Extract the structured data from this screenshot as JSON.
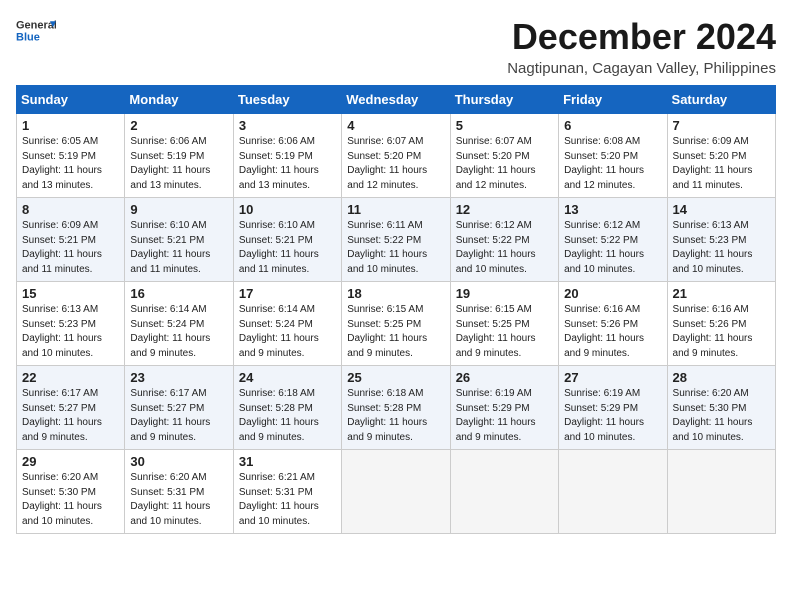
{
  "logo": {
    "line1": "General",
    "line2": "Blue"
  },
  "title": "December 2024",
  "location": "Nagtipunan, Cagayan Valley, Philippines",
  "weekdays": [
    "Sunday",
    "Monday",
    "Tuesday",
    "Wednesday",
    "Thursday",
    "Friday",
    "Saturday"
  ],
  "weeks": [
    [
      {
        "day": "1",
        "sunrise": "6:05 AM",
        "sunset": "5:19 PM",
        "daylight": "11 hours and 13 minutes."
      },
      {
        "day": "2",
        "sunrise": "6:06 AM",
        "sunset": "5:19 PM",
        "daylight": "11 hours and 13 minutes."
      },
      {
        "day": "3",
        "sunrise": "6:06 AM",
        "sunset": "5:19 PM",
        "daylight": "11 hours and 13 minutes."
      },
      {
        "day": "4",
        "sunrise": "6:07 AM",
        "sunset": "5:20 PM",
        "daylight": "11 hours and 12 minutes."
      },
      {
        "day": "5",
        "sunrise": "6:07 AM",
        "sunset": "5:20 PM",
        "daylight": "11 hours and 12 minutes."
      },
      {
        "day": "6",
        "sunrise": "6:08 AM",
        "sunset": "5:20 PM",
        "daylight": "11 hours and 12 minutes."
      },
      {
        "day": "7",
        "sunrise": "6:09 AM",
        "sunset": "5:20 PM",
        "daylight": "11 hours and 11 minutes."
      }
    ],
    [
      {
        "day": "8",
        "sunrise": "6:09 AM",
        "sunset": "5:21 PM",
        "daylight": "11 hours and 11 minutes."
      },
      {
        "day": "9",
        "sunrise": "6:10 AM",
        "sunset": "5:21 PM",
        "daylight": "11 hours and 11 minutes."
      },
      {
        "day": "10",
        "sunrise": "6:10 AM",
        "sunset": "5:21 PM",
        "daylight": "11 hours and 11 minutes."
      },
      {
        "day": "11",
        "sunrise": "6:11 AM",
        "sunset": "5:22 PM",
        "daylight": "11 hours and 10 minutes."
      },
      {
        "day": "12",
        "sunrise": "6:12 AM",
        "sunset": "5:22 PM",
        "daylight": "11 hours and 10 minutes."
      },
      {
        "day": "13",
        "sunrise": "6:12 AM",
        "sunset": "5:22 PM",
        "daylight": "11 hours and 10 minutes."
      },
      {
        "day": "14",
        "sunrise": "6:13 AM",
        "sunset": "5:23 PM",
        "daylight": "11 hours and 10 minutes."
      }
    ],
    [
      {
        "day": "15",
        "sunrise": "6:13 AM",
        "sunset": "5:23 PM",
        "daylight": "11 hours and 10 minutes."
      },
      {
        "day": "16",
        "sunrise": "6:14 AM",
        "sunset": "5:24 PM",
        "daylight": "11 hours and 9 minutes."
      },
      {
        "day": "17",
        "sunrise": "6:14 AM",
        "sunset": "5:24 PM",
        "daylight": "11 hours and 9 minutes."
      },
      {
        "day": "18",
        "sunrise": "6:15 AM",
        "sunset": "5:25 PM",
        "daylight": "11 hours and 9 minutes."
      },
      {
        "day": "19",
        "sunrise": "6:15 AM",
        "sunset": "5:25 PM",
        "daylight": "11 hours and 9 minutes."
      },
      {
        "day": "20",
        "sunrise": "6:16 AM",
        "sunset": "5:26 PM",
        "daylight": "11 hours and 9 minutes."
      },
      {
        "day": "21",
        "sunrise": "6:16 AM",
        "sunset": "5:26 PM",
        "daylight": "11 hours and 9 minutes."
      }
    ],
    [
      {
        "day": "22",
        "sunrise": "6:17 AM",
        "sunset": "5:27 PM",
        "daylight": "11 hours and 9 minutes."
      },
      {
        "day": "23",
        "sunrise": "6:17 AM",
        "sunset": "5:27 PM",
        "daylight": "11 hours and 9 minutes."
      },
      {
        "day": "24",
        "sunrise": "6:18 AM",
        "sunset": "5:28 PM",
        "daylight": "11 hours and 9 minutes."
      },
      {
        "day": "25",
        "sunrise": "6:18 AM",
        "sunset": "5:28 PM",
        "daylight": "11 hours and 9 minutes."
      },
      {
        "day": "26",
        "sunrise": "6:19 AM",
        "sunset": "5:29 PM",
        "daylight": "11 hours and 9 minutes."
      },
      {
        "day": "27",
        "sunrise": "6:19 AM",
        "sunset": "5:29 PM",
        "daylight": "11 hours and 10 minutes."
      },
      {
        "day": "28",
        "sunrise": "6:20 AM",
        "sunset": "5:30 PM",
        "daylight": "11 hours and 10 minutes."
      }
    ],
    [
      {
        "day": "29",
        "sunrise": "6:20 AM",
        "sunset": "5:30 PM",
        "daylight": "11 hours and 10 minutes."
      },
      {
        "day": "30",
        "sunrise": "6:20 AM",
        "sunset": "5:31 PM",
        "daylight": "11 hours and 10 minutes."
      },
      {
        "day": "31",
        "sunrise": "6:21 AM",
        "sunset": "5:31 PM",
        "daylight": "11 hours and 10 minutes."
      },
      null,
      null,
      null,
      null
    ]
  ]
}
